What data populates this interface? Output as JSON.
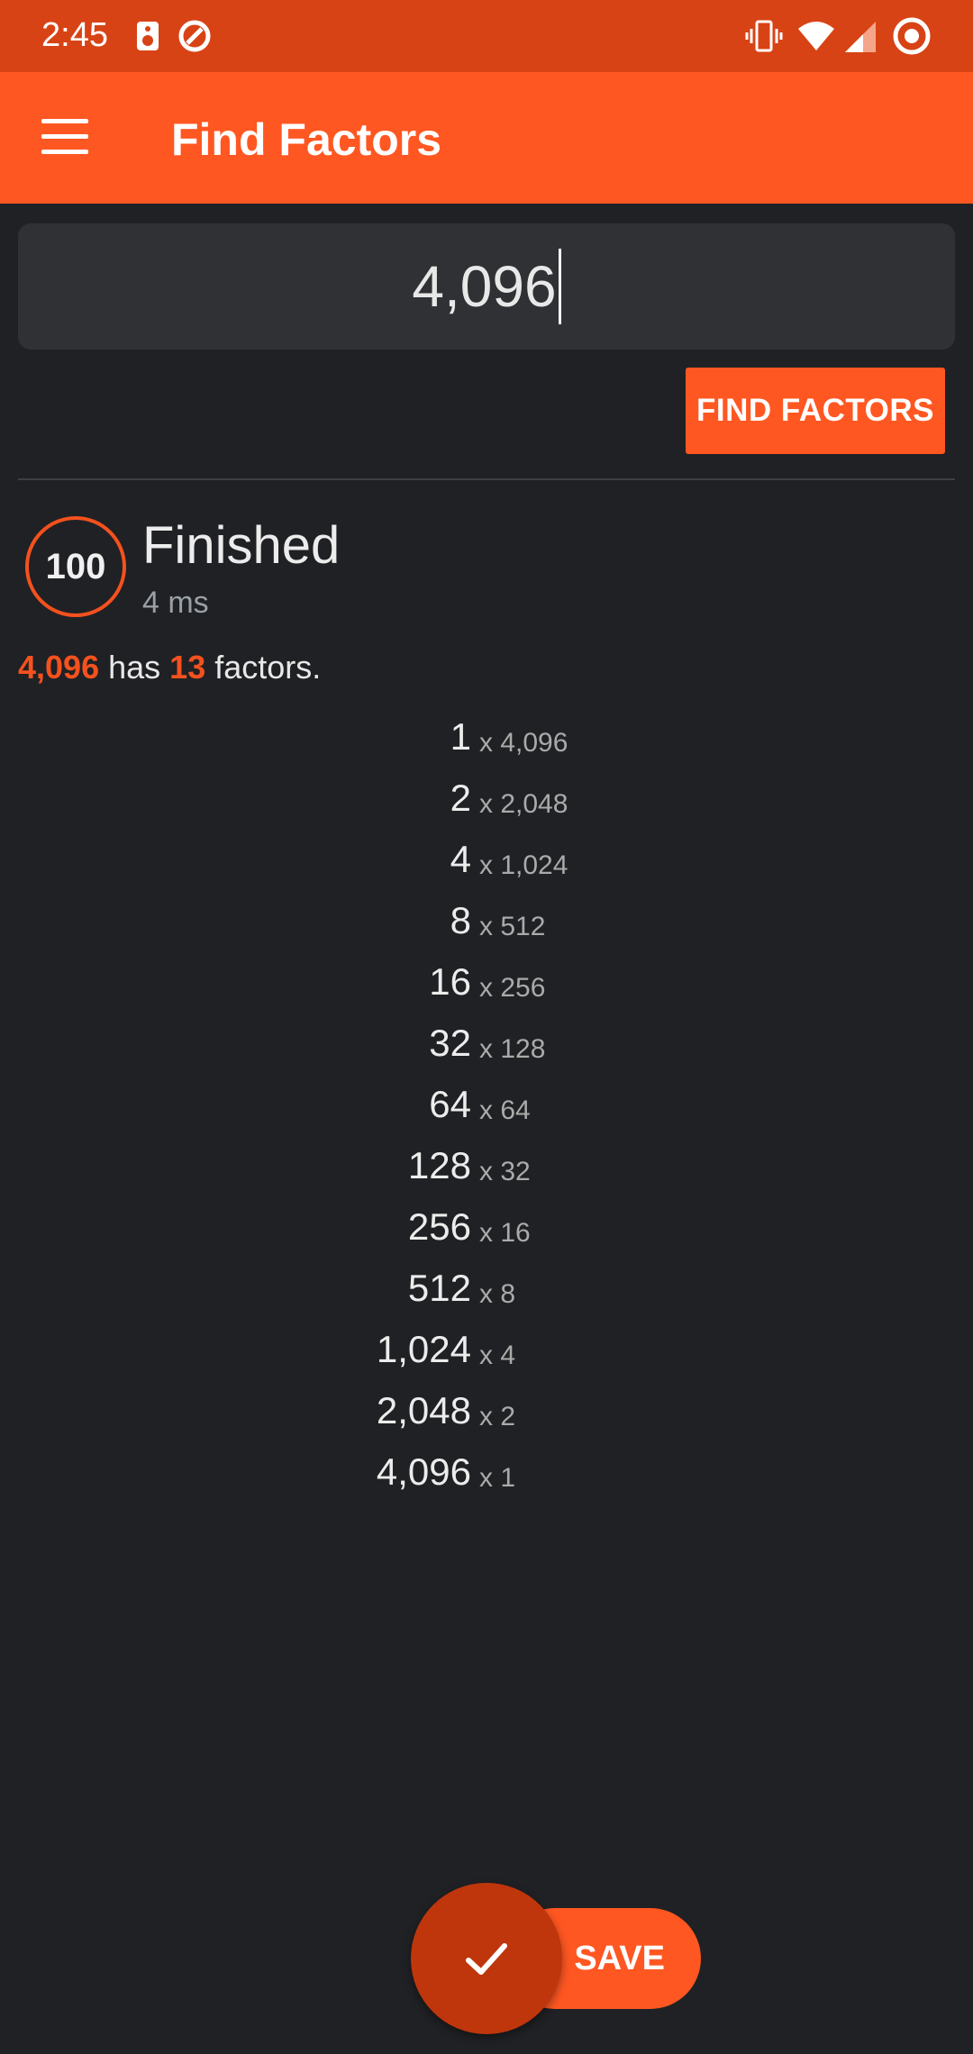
{
  "statusbar": {
    "time": "2:45",
    "icons": [
      "speaker-icon",
      "sync-icon",
      "vibrate-icon",
      "wifi-icon",
      "signal-icon",
      "record-icon"
    ]
  },
  "appbar": {
    "title": "Find Factors",
    "menu_icon": "hamburger-menu-icon"
  },
  "input": {
    "value": "4,096"
  },
  "find_button": {
    "label": "FIND FACTORS"
  },
  "status": {
    "progress": "100",
    "title": "Finished",
    "elapsed": "4 ms"
  },
  "summary": {
    "number": "4,096",
    "has": "has",
    "count": "13",
    "suffix": "factors."
  },
  "factors": [
    {
      "a": "1",
      "b": "x 4,096"
    },
    {
      "a": "2",
      "b": "x 2,048"
    },
    {
      "a": "4",
      "b": "x 1,024"
    },
    {
      "a": "8",
      "b": "x 512"
    },
    {
      "a": "16",
      "b": "x 256"
    },
    {
      "a": "32",
      "b": "x 128"
    },
    {
      "a": "64",
      "b": "x 64"
    },
    {
      "a": "128",
      "b": "x 32"
    },
    {
      "a": "256",
      "b": "x 16"
    },
    {
      "a": "512",
      "b": "x 8"
    },
    {
      "a": "1,024",
      "b": "x 4"
    },
    {
      "a": "2,048",
      "b": "x 2"
    },
    {
      "a": "4,096",
      "b": "x 1"
    }
  ],
  "save": {
    "label": "SAVE",
    "icon": "check-icon"
  },
  "colors": {
    "accent": "#ff5722",
    "statusbar": "#d84315",
    "fab": "#bf360c",
    "background": "#202124"
  }
}
